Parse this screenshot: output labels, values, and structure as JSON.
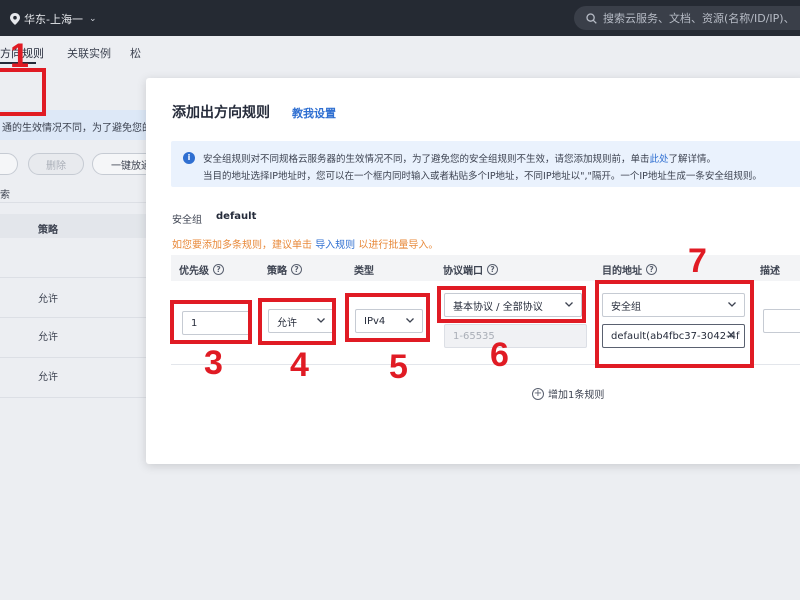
{
  "topbar": {
    "region": "华东-上海一",
    "search_placeholder": "搜索云服务、文档、资源(名称/ID/IP)、"
  },
  "background": {
    "tabs": [
      "方向规则",
      "关联实例",
      "松"
    ],
    "info_text": "通的生效情况不同，为了避免您的安",
    "buttons": [
      "",
      "删除",
      "一键放通"
    ],
    "filter_text": "索",
    "column_header": "策略",
    "rows": [
      "允许",
      "允许",
      "允许"
    ]
  },
  "dialog": {
    "title": "添加出方向规则",
    "help_link": "教我设置",
    "notice_line1_a": "安全组规则对不同规格云服务器的生效情况不同，为了避免您的安全组规则不生效，请您添加规则前，单击",
    "notice_line1_link": "此处",
    "notice_line1_b": "了解详情。",
    "notice_line2": "当目的地址选择IP地址时，您可以在一个框内同时输入或者粘贴多个IP地址，不同IP地址以\",\"隔开。一个IP地址生成一条安全组规则。",
    "sg_label": "安全组",
    "sg_value": "default",
    "tip_a": "如您要添加多条规则，建议单击",
    "tip_link": "导入规则",
    "tip_b": "以进行批量导入。",
    "columns": {
      "priority": "优先级",
      "policy": "策略",
      "type": "类型",
      "protocol_port": "协议端口",
      "destination": "目的地址",
      "description": "描述"
    },
    "row": {
      "priority_value": "1",
      "policy_value": "允许",
      "type_value": "IPv4",
      "protocol_value": "基本协议 / 全部协议",
      "port_placeholder": "1-65535",
      "dest_type_value": "安全组",
      "dest_value": "default(ab4fbc37-3042-4f"
    },
    "add_rule": "增加1条规则"
  },
  "annotations": [
    "1",
    "3",
    "4",
    "5",
    "6",
    "7"
  ],
  "colors": {
    "annotation_red": "#e01b24",
    "link_blue": "#2f6fd1",
    "tip_orange": "#e8893a",
    "topbar_bg": "#252a33"
  }
}
